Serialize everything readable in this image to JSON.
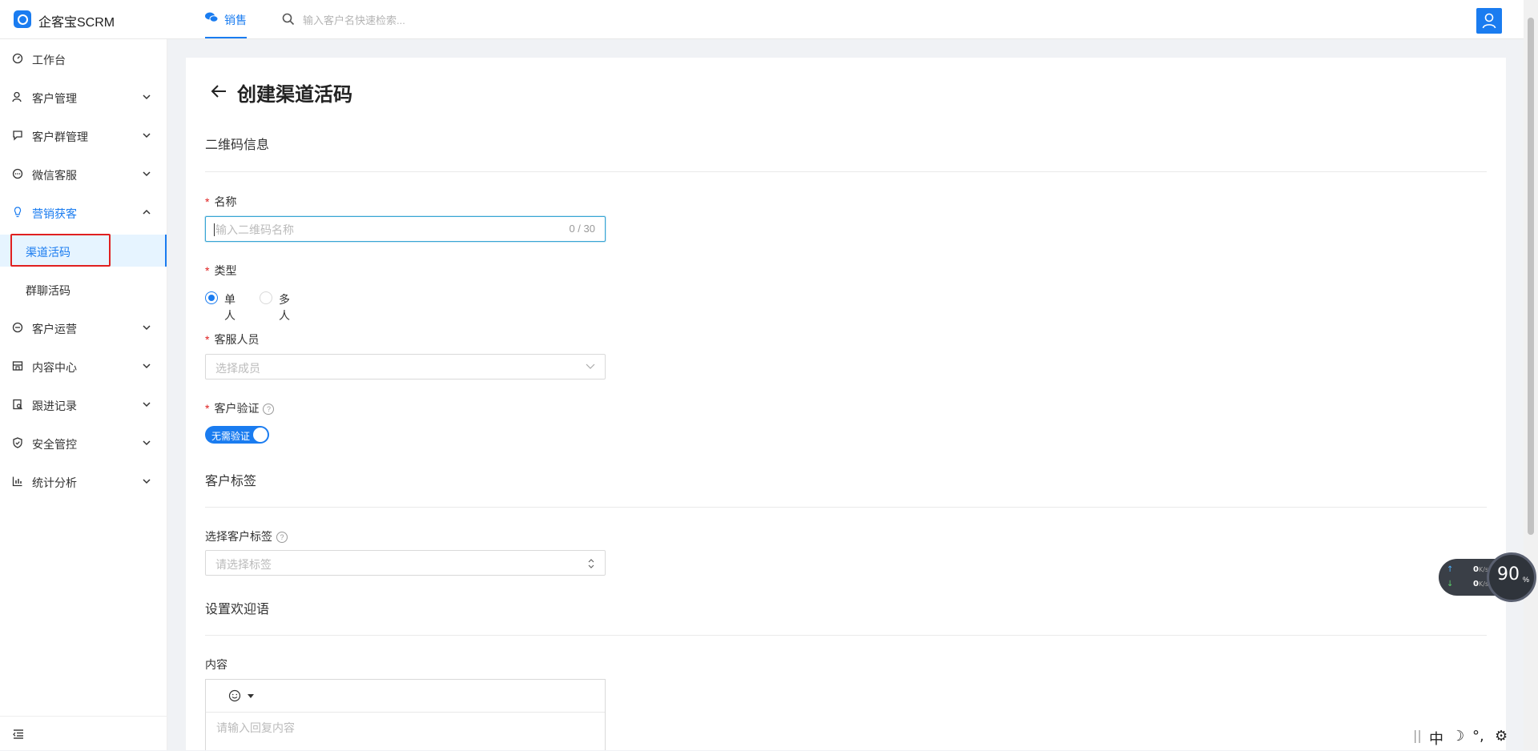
{
  "app": {
    "title": "企客宝SCRM"
  },
  "header": {
    "tab_label": "销售",
    "search_placeholder": "输入客户名快速检索..."
  },
  "sidebar": {
    "items": [
      {
        "label": "工作台",
        "icon": "dashboard-icon"
      },
      {
        "label": "客户管理",
        "icon": "user-icon"
      },
      {
        "label": "客户群管理",
        "icon": "chat-icon"
      },
      {
        "label": "微信客服",
        "icon": "message-icon"
      },
      {
        "label": "营销获客",
        "icon": "bulb-icon"
      },
      {
        "label": "客户运营",
        "icon": "operation-icon"
      },
      {
        "label": "内容中心",
        "icon": "shop-icon"
      },
      {
        "label": "跟进记录",
        "icon": "record-icon"
      },
      {
        "label": "安全管控",
        "icon": "shield-icon"
      },
      {
        "label": "统计分析",
        "icon": "chart-icon"
      }
    ],
    "sub_items": [
      {
        "label": "渠道活码",
        "active": true
      },
      {
        "label": "群聊活码",
        "active": false
      }
    ]
  },
  "page": {
    "title": "创建渠道活码",
    "section_qr": "二维码信息",
    "name_label": "名称",
    "name_placeholder": "输入二维码名称",
    "name_counter": "0 / 30",
    "type_label": "类型",
    "type_options": [
      "单人",
      "多人"
    ],
    "type_selected": "单人",
    "staff_label": "客服人员",
    "staff_placeholder": "选择成员",
    "verify_label": "客户验证",
    "verify_toggle": "无需验证",
    "section_tags": "客户标签",
    "tags_label": "选择客户标签",
    "tags_placeholder": "请选择标签",
    "section_welcome": "设置欢迎语",
    "content_label": "内容",
    "content_placeholder": "请输入回复内容"
  },
  "speed_widget": {
    "upload": "0",
    "download": "0",
    "unit": "K/s",
    "percent": "90",
    "percent_sign": "%"
  },
  "ime": {
    "mode": "中"
  },
  "colors": {
    "accent": "#1a7cf0",
    "required": "#e02020"
  }
}
